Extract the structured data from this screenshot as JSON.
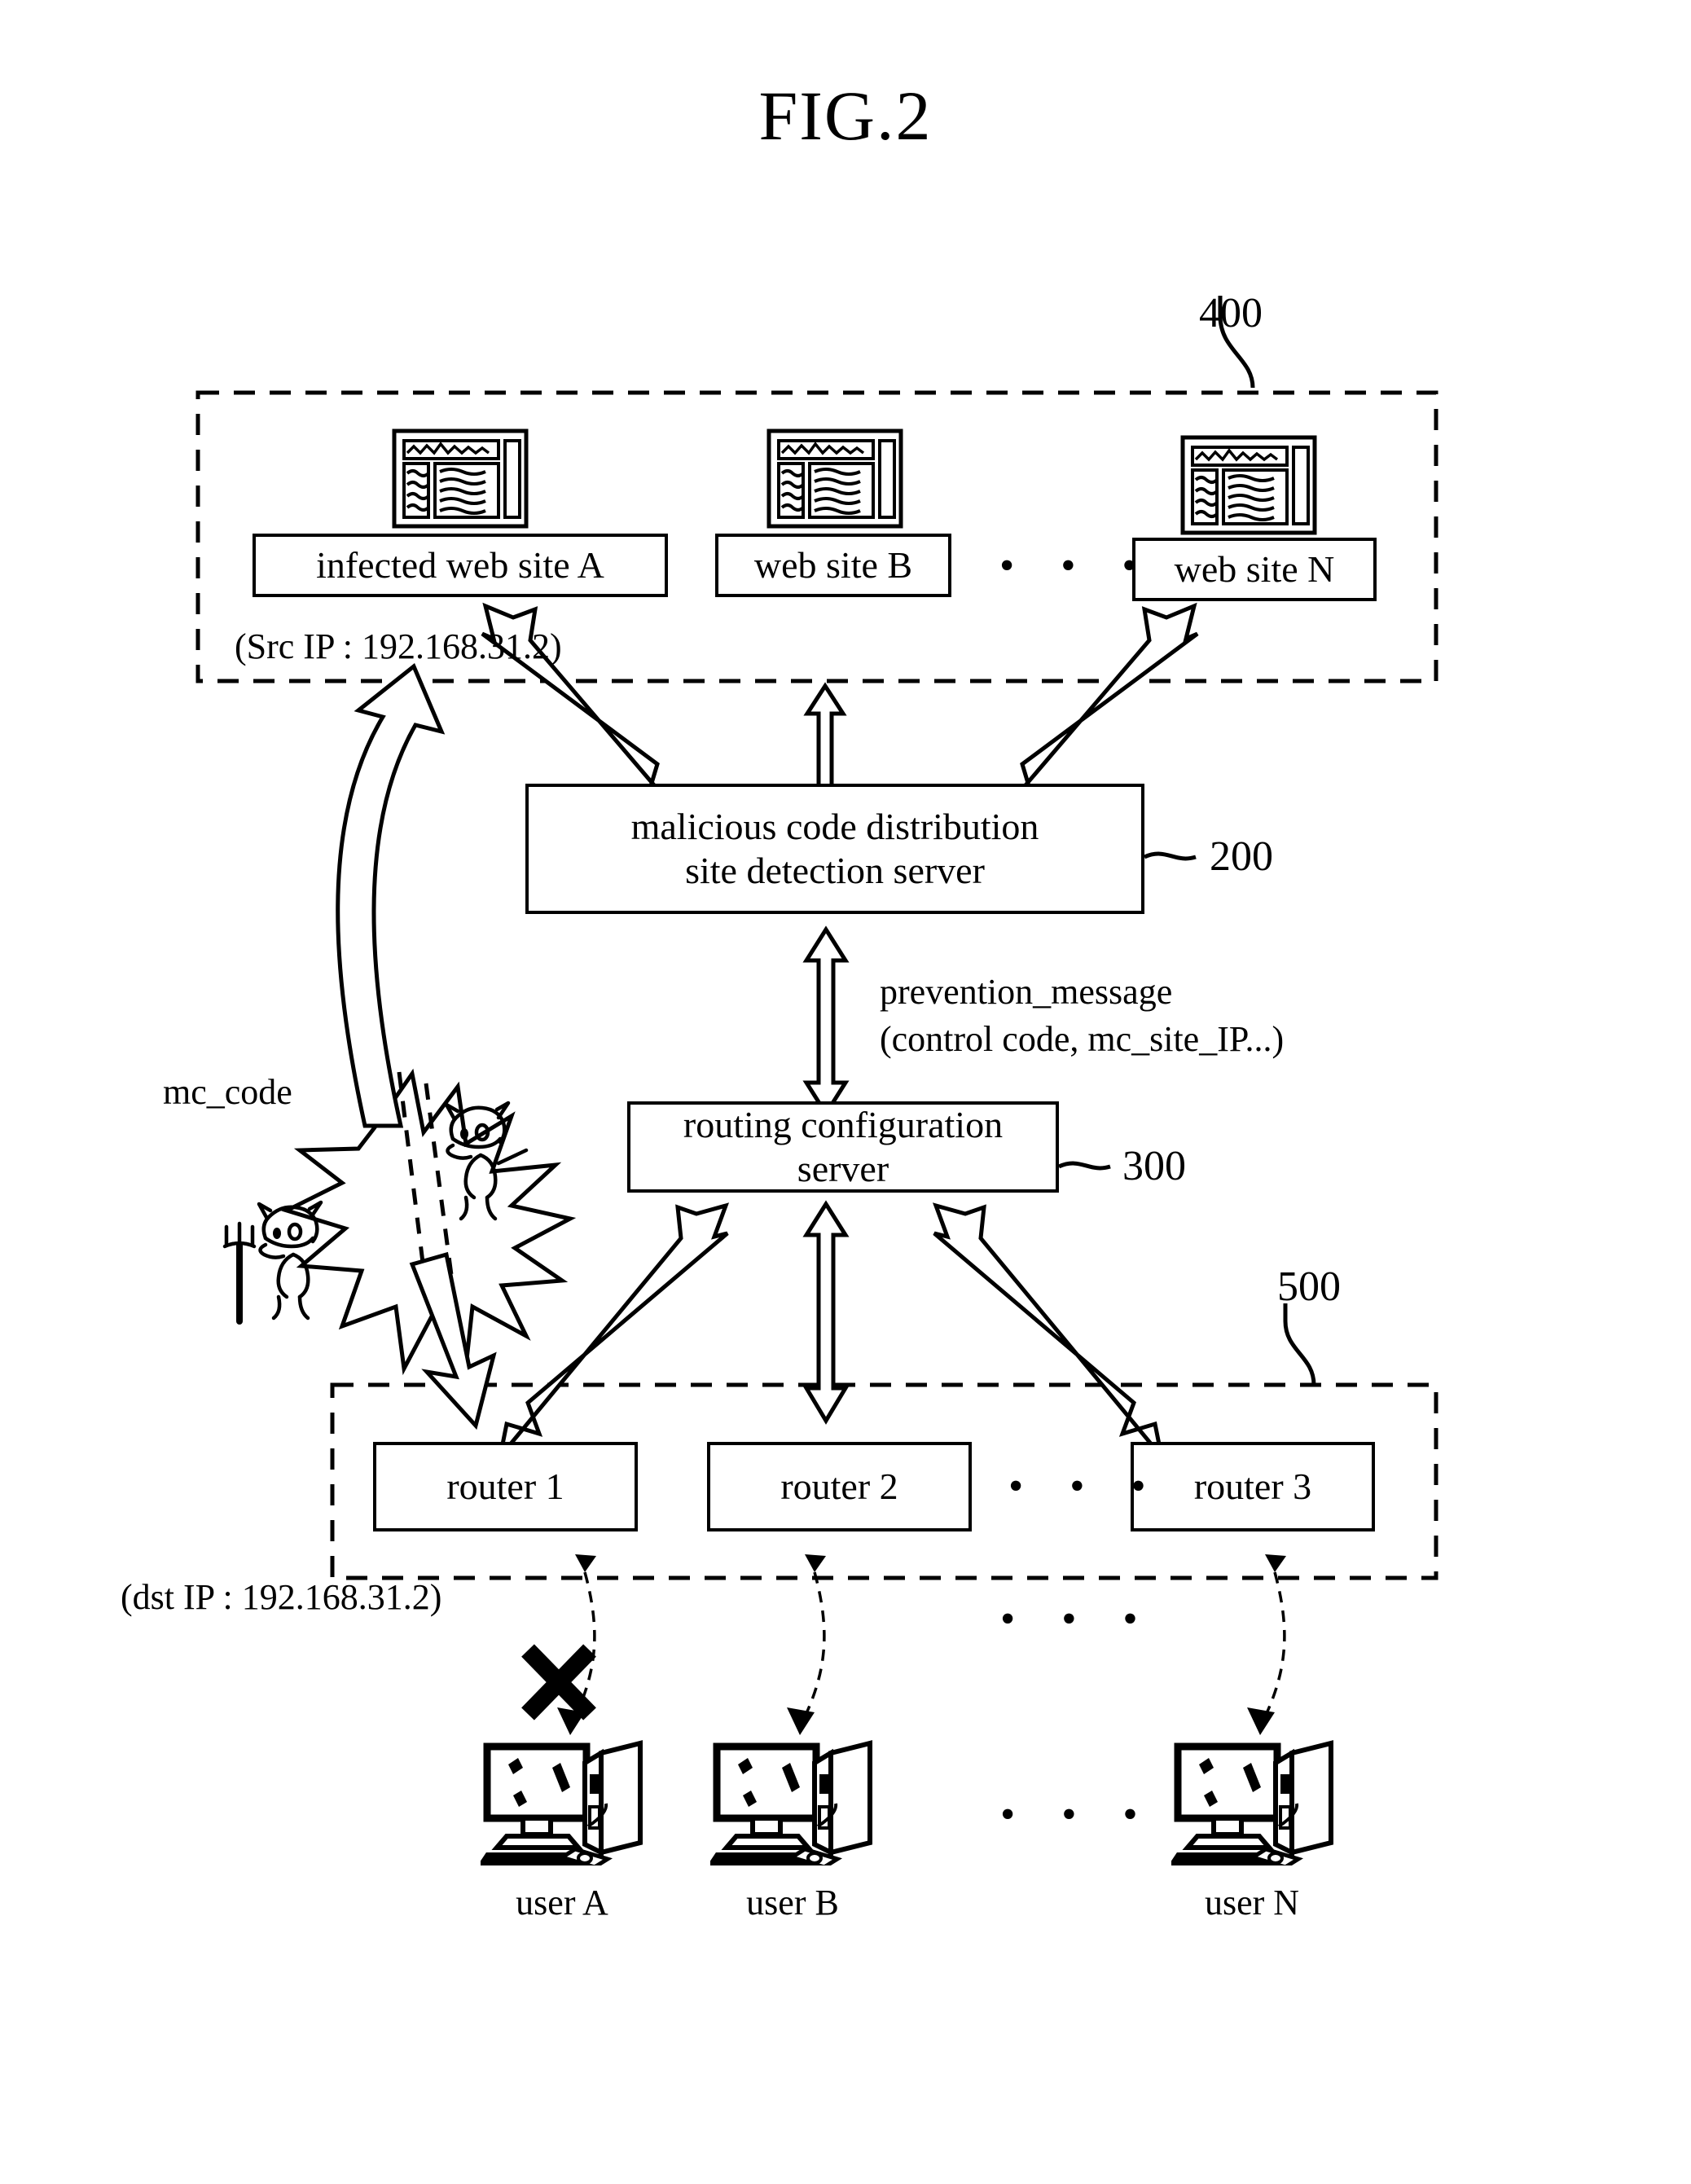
{
  "figure": {
    "title": "FIG.2"
  },
  "groups": {
    "web_sites": {
      "ref": "400",
      "src_ip_label": "(Src IP : 192.168.31.2)",
      "ellipsis": "• • •",
      "items": [
        {
          "label": "infected web site A",
          "icon": "browser-window-icon"
        },
        {
          "label": "web site B",
          "icon": "browser-window-icon"
        },
        {
          "label": "web site N",
          "icon": "browser-window-icon"
        }
      ]
    },
    "routers": {
      "ref": "500",
      "dst_ip_label": "(dst IP : 192.168.31.2)",
      "ellipsis": "• • •",
      "items": [
        {
          "label": "router 1"
        },
        {
          "label": "router 2"
        },
        {
          "label": "router 3"
        }
      ]
    },
    "users": {
      "ellipsis_top": "• • •",
      "ellipsis_bottom": "• • •",
      "items": [
        {
          "label": "user A",
          "icon": "desktop-computer-icon",
          "blocked": true
        },
        {
          "label": "user B",
          "icon": "desktop-computer-icon",
          "blocked": false
        },
        {
          "label": "user N",
          "icon": "desktop-computer-icon",
          "blocked": false
        }
      ]
    }
  },
  "servers": {
    "detection": {
      "line1": "malicious code distribution",
      "line2": "site detection server",
      "ref": "200"
    },
    "routing": {
      "line1": "routing configuration",
      "line2": "server",
      "ref": "300"
    }
  },
  "annotations": {
    "prevention_line1": "prevention_message",
    "prevention_line2": "(control code, mc_site_IP...)",
    "mc_code": "mc_code"
  },
  "colors": {
    "ink": "#000000",
    "paper": "#ffffff"
  }
}
